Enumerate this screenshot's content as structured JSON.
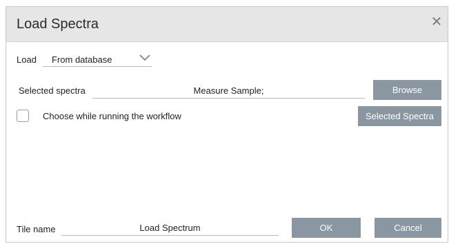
{
  "dialog": {
    "title": "Load Spectra",
    "close_label": "✕"
  },
  "load": {
    "label": "Load",
    "selected_value": "From database",
    "chevron_icon": "chevron-down-icon"
  },
  "selected_spectra": {
    "label": "Selected spectra",
    "value": "Measure Sample;",
    "browse_label": "Browse"
  },
  "choose_option": {
    "checked": false,
    "label": "Choose while running the workflow",
    "selected_spectra_button_label": "Selected Spectra"
  },
  "tile_name": {
    "label": "Tile name",
    "value": "Load Spectrum"
  },
  "footer": {
    "ok_label": "OK",
    "cancel_label": "Cancel"
  },
  "colors": {
    "button_bg": "#8a96a1",
    "title_bar_bg": "#e6e6e6"
  }
}
